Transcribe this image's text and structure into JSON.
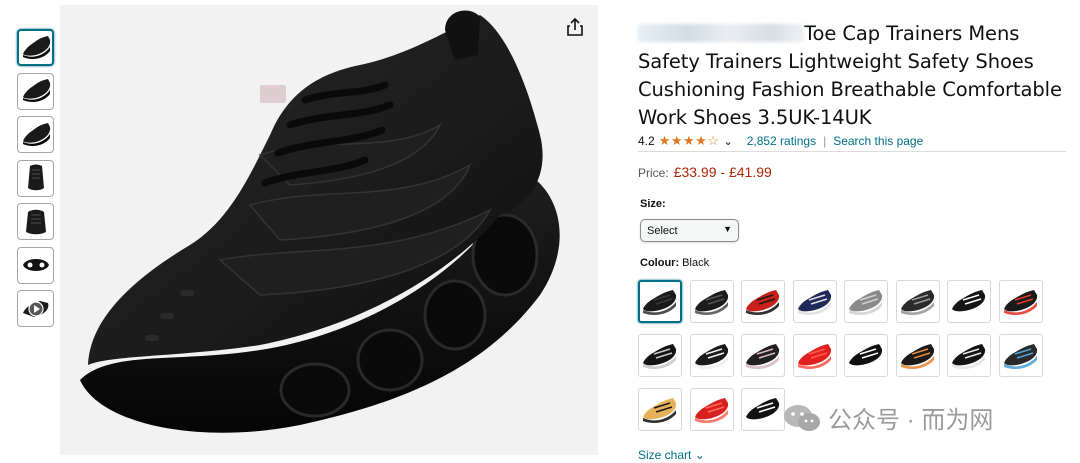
{
  "thumbnails": [
    {
      "name": "thumb-side",
      "kind": "side"
    },
    {
      "name": "thumb-side-2",
      "kind": "side"
    },
    {
      "name": "thumb-side-3",
      "kind": "side"
    },
    {
      "name": "thumb-back",
      "kind": "back"
    },
    {
      "name": "thumb-front",
      "kind": "front"
    },
    {
      "name": "thumb-sole",
      "kind": "sole"
    },
    {
      "name": "thumb-video",
      "kind": "video"
    }
  ],
  "product": {
    "title": "Toe Cap Trainers Mens Safety Trainers Lightweight Safety Shoes Cushioning Fashion Breathable Comfortable Work Shoes 3.5UK-14UK",
    "rating": "4.2",
    "stars": "★★★★☆",
    "ratings_link": "2,852 ratings",
    "search_link": "Search this page",
    "price_label": "Price:",
    "price": "£33.99 - £41.99"
  },
  "size": {
    "label": "Size:",
    "selected": "Select"
  },
  "colour": {
    "label": "Colour:",
    "selected": "Black",
    "swatches": [
      {
        "body": "#1a1a1a",
        "accent": "#3a3a3a"
      },
      {
        "body": "#1c1c1c",
        "accent": "#555555"
      },
      {
        "body": "#c8201b",
        "accent": "#1a1a1a"
      },
      {
        "body": "#1f2a5a",
        "accent": "#e0e0e0"
      },
      {
        "body": "#8a8a8a",
        "accent": "#d0d0d0"
      },
      {
        "body": "#2b2b2b",
        "accent": "#9a9a9a"
      },
      {
        "body": "#151515",
        "accent": "#ffffff"
      },
      {
        "body": "#1a1a1a",
        "accent": "#e23b2b"
      },
      {
        "body": "#141414",
        "accent": "#c9c9c9"
      },
      {
        "body": "#1a1a1a",
        "accent": "#f0f0f0"
      },
      {
        "body": "#202020",
        "accent": "#d8b8c8"
      },
      {
        "body": "#e01f1f",
        "accent": "#ff5a4a"
      },
      {
        "body": "#111111",
        "accent": "#ffffff"
      },
      {
        "body": "#1a1a1a",
        "accent": "#e88a3a"
      },
      {
        "body": "#141414",
        "accent": "#e6e6e6"
      },
      {
        "body": "#2a2a2a",
        "accent": "#4ea3d9"
      },
      {
        "body": "#e6b35a",
        "accent": "#1a1a1a"
      },
      {
        "body": "#d92020",
        "accent": "#ff6b5b"
      },
      {
        "body": "#121212",
        "accent": "#ffffff"
      }
    ]
  },
  "size_chart": "Size chart",
  "watermark": "公众号 · 而为网",
  "colors": {
    "link": "#007185",
    "price": "#b12704",
    "star": "#de7921",
    "selected_border": "#007185"
  }
}
